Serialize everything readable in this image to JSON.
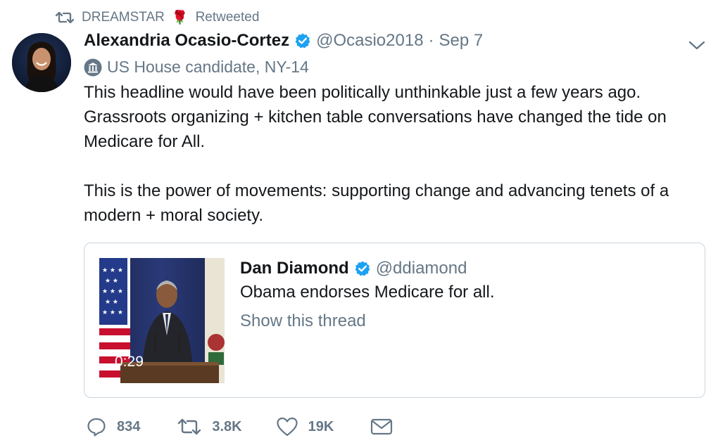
{
  "retweet": {
    "user": "DREAMSTAR",
    "emoji": "🌹",
    "status": "Retweeted"
  },
  "tweet": {
    "author_name": "Alexandria Ocasio-Cortez",
    "handle": "@Ocasio2018",
    "separator": "·",
    "date": "Sep 7",
    "label": "US House candidate, NY-14",
    "paragraphs": [
      "This headline would have been politically unthinkable just a few years ago. Grassroots organizing + kitchen table conversations have changed the tide on Medicare for All.",
      "This is the power of movements: supporting change and advancing tenets of a modern + moral society."
    ]
  },
  "quote": {
    "author_name": "Dan Diamond",
    "handle": "@ddiamond",
    "text": "Obama endorses Medicare for all.",
    "thread_link": "Show this thread",
    "video_duration": "0:29"
  },
  "actions": {
    "replies": "834",
    "retweets": "3.8K",
    "likes": "19K"
  },
  "icons": {
    "retweet": "retweet-icon",
    "verified": "verified-badge-icon",
    "government": "government-building-icon",
    "menu": "chevron-down-icon",
    "reply": "reply-icon",
    "like": "heart-icon",
    "message": "envelope-icon"
  },
  "colors": {
    "verified": "#1da1f2",
    "muted": "#657786",
    "text": "#14171a",
    "border": "#ccd6dd"
  }
}
